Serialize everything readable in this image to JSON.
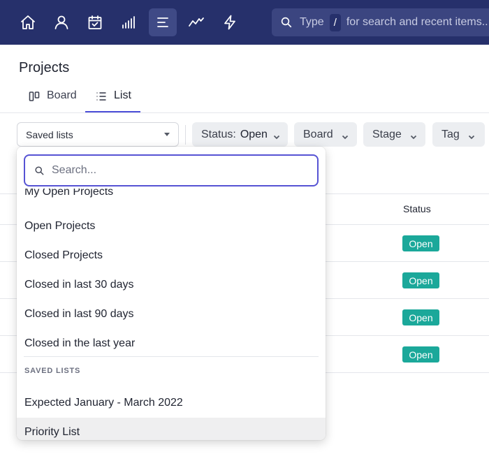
{
  "nav": {
    "icons": [
      "home-icon",
      "person-icon",
      "calendar-check-icon",
      "signal-bars-icon",
      "list-lines-icon",
      "activity-icon",
      "lightning-icon"
    ],
    "active_icon": "list-lines-icon",
    "search": {
      "prefix": "Type",
      "shortcut": "/",
      "suffix": "for search and recent items..."
    }
  },
  "page": {
    "title": "Projects",
    "tabs": [
      {
        "label": "Board",
        "icon": "board-columns-icon"
      },
      {
        "label": "List",
        "icon": "list-icon",
        "active": true
      }
    ]
  },
  "filters": {
    "saved_lists_label": "Saved lists",
    "status_label": "Status:",
    "status_value": "Open",
    "board_label": "Board",
    "stage_label": "Stage",
    "tag_label": "Tag"
  },
  "table": {
    "status_header": "Status",
    "status_values": [
      "Open",
      "Open",
      "Open",
      "Open"
    ],
    "status_color": "#1ba89a"
  },
  "dropdown": {
    "search_placeholder": "Search...",
    "items": [
      "My Open Projects",
      "Open Projects",
      "Closed Projects",
      "Closed in last 30 days",
      "Closed in last 90 days",
      "Closed in the last year"
    ],
    "saved_section_title": "SAVED LISTS",
    "saved_items": [
      "Expected January - March 2022",
      "Priority List"
    ],
    "focus_color": "#5653d4"
  },
  "colors": {
    "nav_background": "#26306b",
    "accent": "#4c4fd8"
  }
}
